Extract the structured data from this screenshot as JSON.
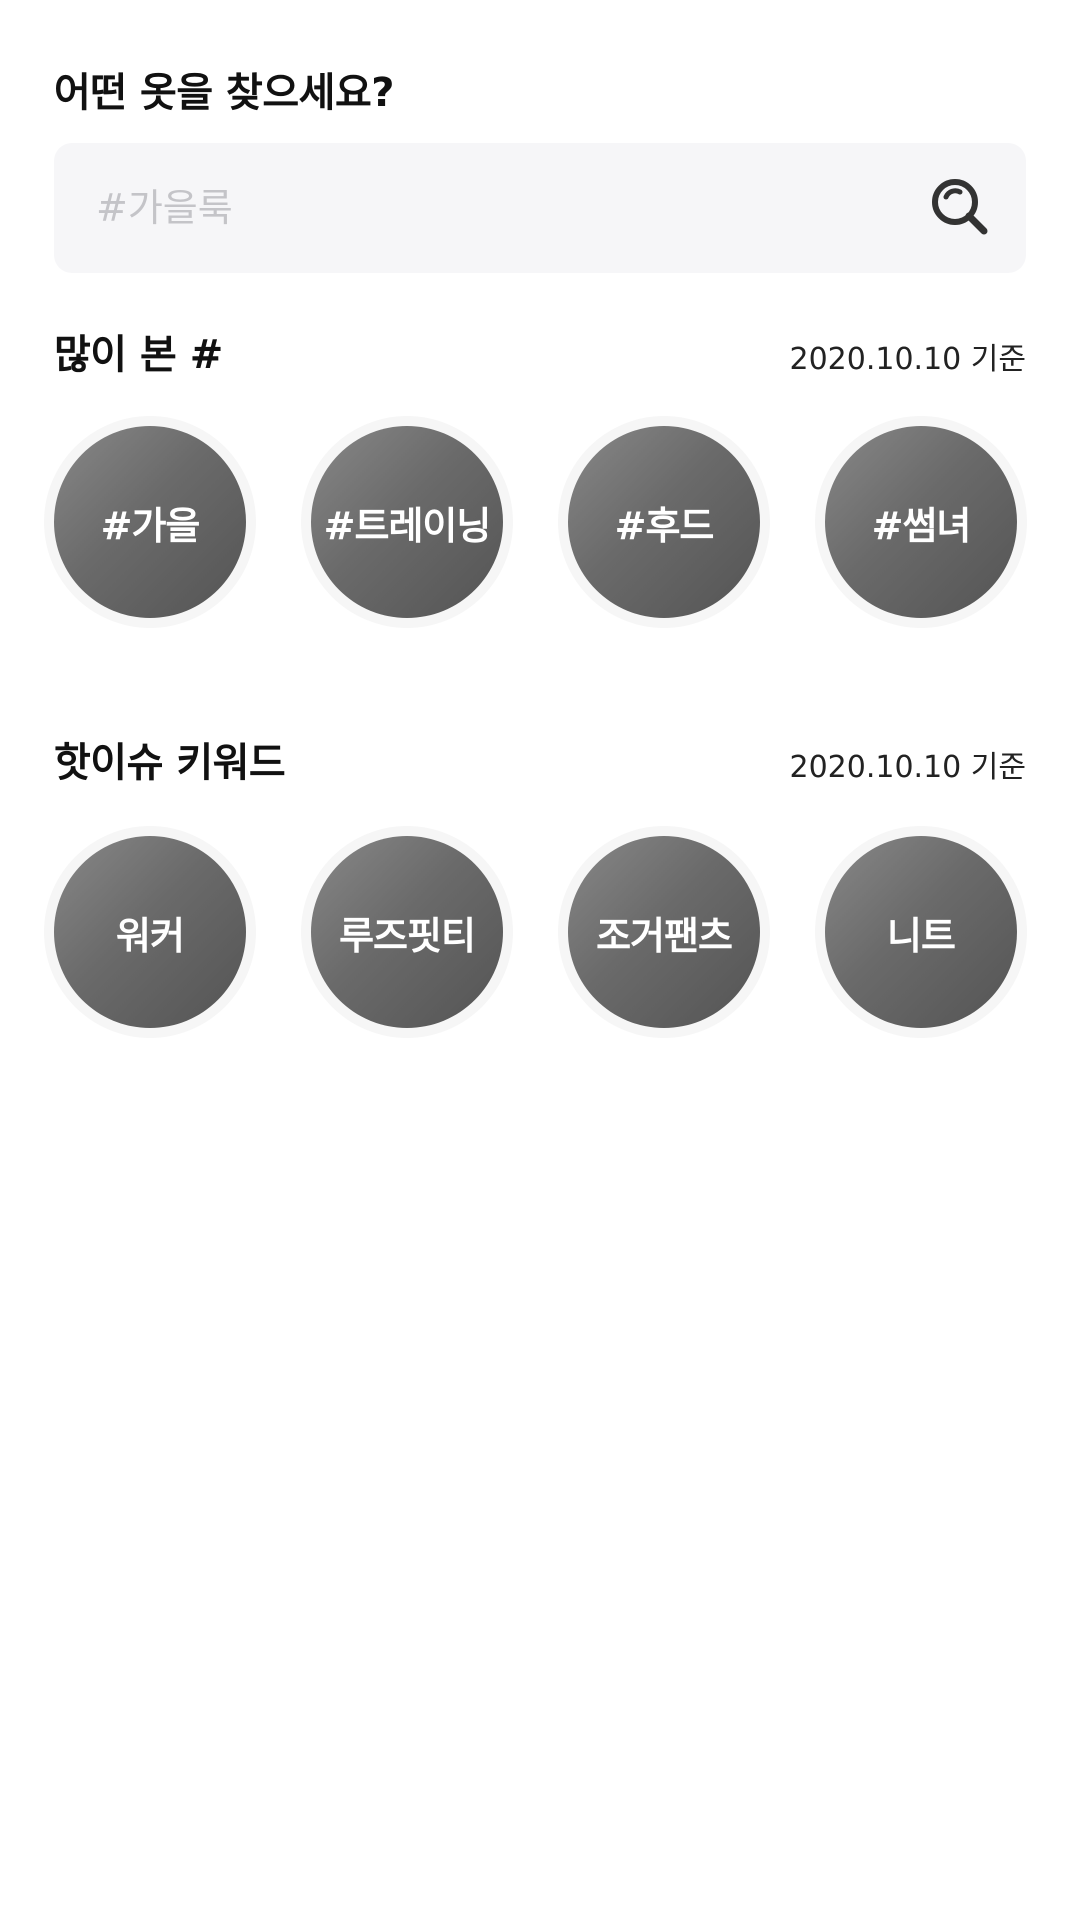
{
  "header": {
    "title": "어떤 옷을 찾으세요?"
  },
  "search": {
    "placeholder": "#가을룩",
    "value": "",
    "icon": "search-icon"
  },
  "most_viewed": {
    "title": "많이 본 #",
    "date": "2020.10.10 기준",
    "tags": [
      {
        "label": "#가을"
      },
      {
        "label": "#트레이닝"
      },
      {
        "label": "#후드"
      },
      {
        "label": "#썸녀"
      }
    ]
  },
  "hot_issue": {
    "title": "핫이슈 키워드",
    "date": "2020.10.10 기준",
    "keywords": [
      {
        "label": "워커"
      },
      {
        "label": "루즈핏티"
      },
      {
        "label": "조거팬츠"
      },
      {
        "label": "니트"
      }
    ]
  },
  "colors": {
    "background": "#ffffff",
    "search_background": "#f6f6f8",
    "placeholder": "#c4c4c8",
    "chip_gradient_start": "#888888",
    "chip_gradient_end": "#545454",
    "chip_ring": "#f6f6f6",
    "chip_text": "#ffffff",
    "text": "#111111"
  }
}
